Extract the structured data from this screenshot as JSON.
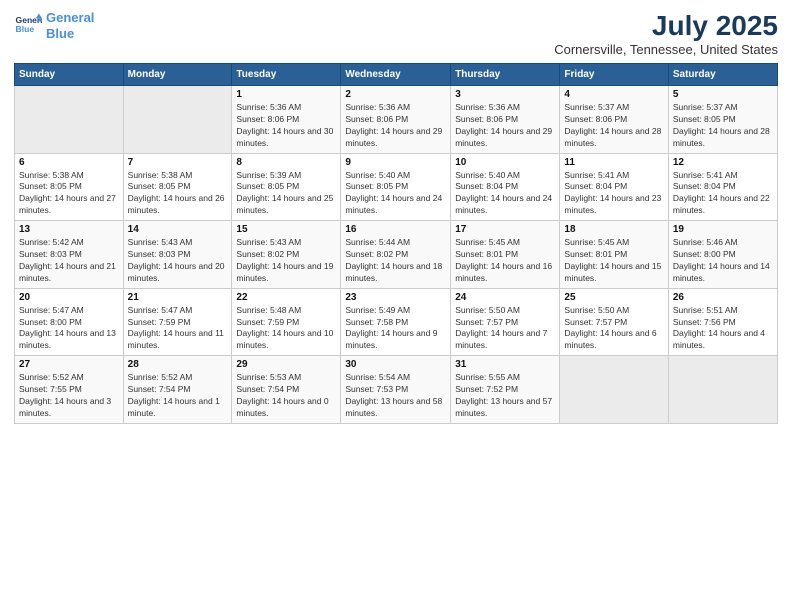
{
  "logo": {
    "line1": "General",
    "line2": "Blue"
  },
  "title": "July 2025",
  "subtitle": "Cornersville, Tennessee, United States",
  "weekdays": [
    "Sunday",
    "Monday",
    "Tuesday",
    "Wednesday",
    "Thursday",
    "Friday",
    "Saturday"
  ],
  "weeks": [
    [
      {
        "day": "",
        "detail": ""
      },
      {
        "day": "",
        "detail": ""
      },
      {
        "day": "1",
        "detail": "Sunrise: 5:36 AM\nSunset: 8:06 PM\nDaylight: 14 hours and 30 minutes."
      },
      {
        "day": "2",
        "detail": "Sunrise: 5:36 AM\nSunset: 8:06 PM\nDaylight: 14 hours and 29 minutes."
      },
      {
        "day": "3",
        "detail": "Sunrise: 5:36 AM\nSunset: 8:06 PM\nDaylight: 14 hours and 29 minutes."
      },
      {
        "day": "4",
        "detail": "Sunrise: 5:37 AM\nSunset: 8:06 PM\nDaylight: 14 hours and 28 minutes."
      },
      {
        "day": "5",
        "detail": "Sunrise: 5:37 AM\nSunset: 8:05 PM\nDaylight: 14 hours and 28 minutes."
      }
    ],
    [
      {
        "day": "6",
        "detail": "Sunrise: 5:38 AM\nSunset: 8:05 PM\nDaylight: 14 hours and 27 minutes."
      },
      {
        "day": "7",
        "detail": "Sunrise: 5:38 AM\nSunset: 8:05 PM\nDaylight: 14 hours and 26 minutes."
      },
      {
        "day": "8",
        "detail": "Sunrise: 5:39 AM\nSunset: 8:05 PM\nDaylight: 14 hours and 25 minutes."
      },
      {
        "day": "9",
        "detail": "Sunrise: 5:40 AM\nSunset: 8:05 PM\nDaylight: 14 hours and 24 minutes."
      },
      {
        "day": "10",
        "detail": "Sunrise: 5:40 AM\nSunset: 8:04 PM\nDaylight: 14 hours and 24 minutes."
      },
      {
        "day": "11",
        "detail": "Sunrise: 5:41 AM\nSunset: 8:04 PM\nDaylight: 14 hours and 23 minutes."
      },
      {
        "day": "12",
        "detail": "Sunrise: 5:41 AM\nSunset: 8:04 PM\nDaylight: 14 hours and 22 minutes."
      }
    ],
    [
      {
        "day": "13",
        "detail": "Sunrise: 5:42 AM\nSunset: 8:03 PM\nDaylight: 14 hours and 21 minutes."
      },
      {
        "day": "14",
        "detail": "Sunrise: 5:43 AM\nSunset: 8:03 PM\nDaylight: 14 hours and 20 minutes."
      },
      {
        "day": "15",
        "detail": "Sunrise: 5:43 AM\nSunset: 8:02 PM\nDaylight: 14 hours and 19 minutes."
      },
      {
        "day": "16",
        "detail": "Sunrise: 5:44 AM\nSunset: 8:02 PM\nDaylight: 14 hours and 18 minutes."
      },
      {
        "day": "17",
        "detail": "Sunrise: 5:45 AM\nSunset: 8:01 PM\nDaylight: 14 hours and 16 minutes."
      },
      {
        "day": "18",
        "detail": "Sunrise: 5:45 AM\nSunset: 8:01 PM\nDaylight: 14 hours and 15 minutes."
      },
      {
        "day": "19",
        "detail": "Sunrise: 5:46 AM\nSunset: 8:00 PM\nDaylight: 14 hours and 14 minutes."
      }
    ],
    [
      {
        "day": "20",
        "detail": "Sunrise: 5:47 AM\nSunset: 8:00 PM\nDaylight: 14 hours and 13 minutes."
      },
      {
        "day": "21",
        "detail": "Sunrise: 5:47 AM\nSunset: 7:59 PM\nDaylight: 14 hours and 11 minutes."
      },
      {
        "day": "22",
        "detail": "Sunrise: 5:48 AM\nSunset: 7:59 PM\nDaylight: 14 hours and 10 minutes."
      },
      {
        "day": "23",
        "detail": "Sunrise: 5:49 AM\nSunset: 7:58 PM\nDaylight: 14 hours and 9 minutes."
      },
      {
        "day": "24",
        "detail": "Sunrise: 5:50 AM\nSunset: 7:57 PM\nDaylight: 14 hours and 7 minutes."
      },
      {
        "day": "25",
        "detail": "Sunrise: 5:50 AM\nSunset: 7:57 PM\nDaylight: 14 hours and 6 minutes."
      },
      {
        "day": "26",
        "detail": "Sunrise: 5:51 AM\nSunset: 7:56 PM\nDaylight: 14 hours and 4 minutes."
      }
    ],
    [
      {
        "day": "27",
        "detail": "Sunrise: 5:52 AM\nSunset: 7:55 PM\nDaylight: 14 hours and 3 minutes."
      },
      {
        "day": "28",
        "detail": "Sunrise: 5:52 AM\nSunset: 7:54 PM\nDaylight: 14 hours and 1 minute."
      },
      {
        "day": "29",
        "detail": "Sunrise: 5:53 AM\nSunset: 7:54 PM\nDaylight: 14 hours and 0 minutes."
      },
      {
        "day": "30",
        "detail": "Sunrise: 5:54 AM\nSunset: 7:53 PM\nDaylight: 13 hours and 58 minutes."
      },
      {
        "day": "31",
        "detail": "Sunrise: 5:55 AM\nSunset: 7:52 PM\nDaylight: 13 hours and 57 minutes."
      },
      {
        "day": "",
        "detail": ""
      },
      {
        "day": "",
        "detail": ""
      }
    ]
  ]
}
